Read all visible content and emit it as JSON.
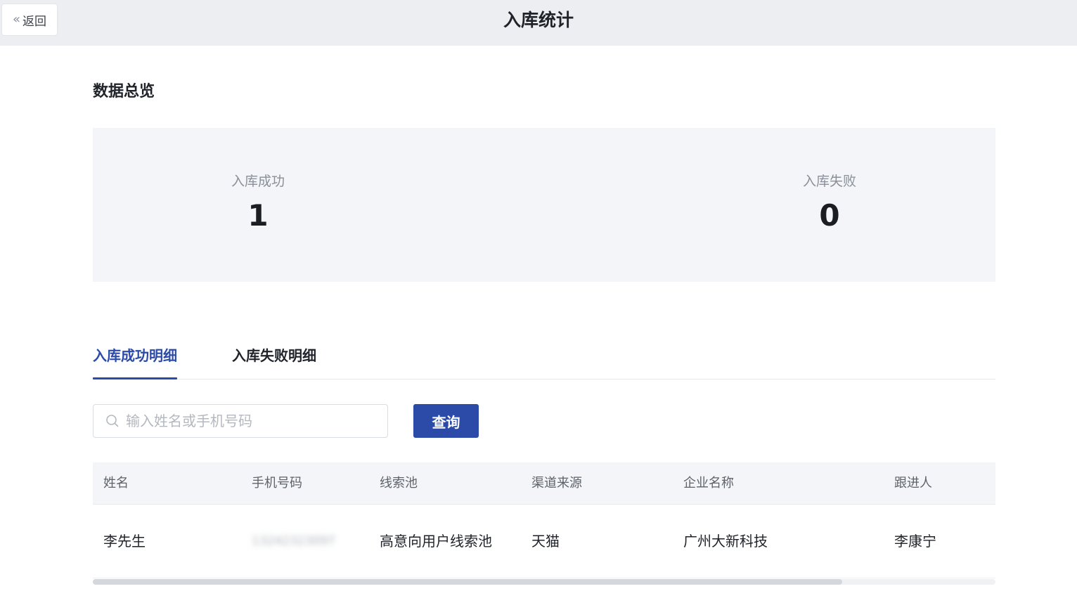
{
  "header": {
    "back_label": "返回",
    "title": "入库统计"
  },
  "overview": {
    "title": "数据总览",
    "success": {
      "label": "入库成功",
      "value": "1"
    },
    "fail": {
      "label": "入库失败",
      "value": "0"
    }
  },
  "tabs": [
    {
      "label": "入库成功明细",
      "active": true
    },
    {
      "label": "入库失败明细",
      "active": false
    }
  ],
  "search": {
    "placeholder": "输入姓名或手机号码",
    "value": "",
    "button_label": "查询"
  },
  "table": {
    "columns": [
      "姓名",
      "手机号码",
      "线索池",
      "渠道来源",
      "企业名称",
      "跟进人"
    ],
    "rows": [
      [
        "李先生",
        "13242323097",
        "高意向用户线索池",
        "天猫",
        "广州大新科技",
        "李康宁"
      ]
    ]
  },
  "colors": {
    "accent": "#2c4aa8",
    "header_bg": "#eceef2",
    "panel_bg": "#f3f5f8"
  },
  "scrollbar": {
    "visible_fraction": 0.83
  }
}
